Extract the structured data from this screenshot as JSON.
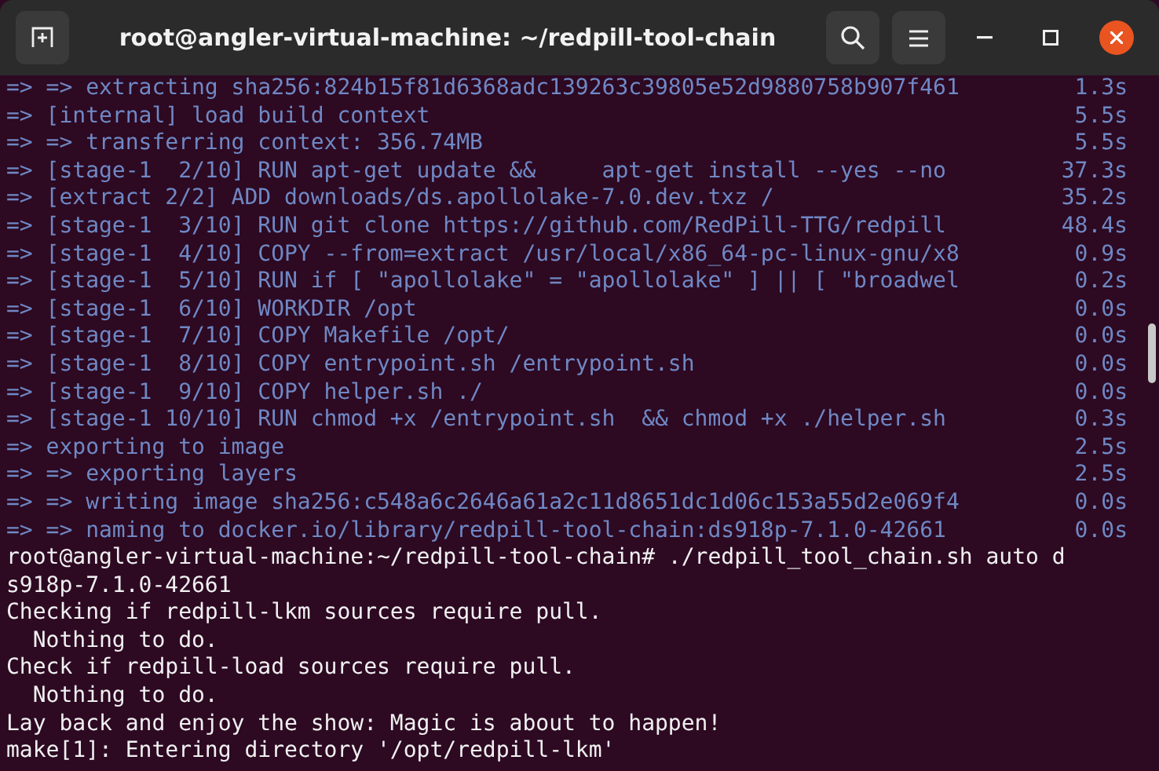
{
  "window": {
    "title": "root@angler-virtual-machine: ~/redpill-tool-chain"
  },
  "terminal": {
    "lines": [
      {
        "kind": "build",
        "text": "=> => extracting sha256:824b15f81d6368adc139263c39805e52d9880758b907f461",
        "time": "1.3s"
      },
      {
        "kind": "build",
        "text": "=> [internal] load build context",
        "time": "5.5s"
      },
      {
        "kind": "build",
        "text": "=> => transferring context: 356.74MB",
        "time": "5.5s"
      },
      {
        "kind": "build",
        "text": "=> [stage-1  2/10] RUN apt-get update &&     apt-get install --yes --no",
        "time": "37.3s"
      },
      {
        "kind": "build",
        "text": "=> [extract 2/2] ADD downloads/ds.apollolake-7.0.dev.txz /",
        "time": "35.2s"
      },
      {
        "kind": "build",
        "text": "=> [stage-1  3/10] RUN git clone https://github.com/RedPill-TTG/redpill",
        "time": "48.4s"
      },
      {
        "kind": "build",
        "text": "=> [stage-1  4/10] COPY --from=extract /usr/local/x86_64-pc-linux-gnu/x8",
        "time": "0.9s"
      },
      {
        "kind": "build",
        "text": "=> [stage-1  5/10] RUN if [ \"apollolake\" = \"apollolake\" ] || [ \"broadwel",
        "time": "0.2s"
      },
      {
        "kind": "build",
        "text": "=> [stage-1  6/10] WORKDIR /opt",
        "time": "0.0s"
      },
      {
        "kind": "build",
        "text": "=> [stage-1  7/10] COPY Makefile /opt/",
        "time": "0.0s"
      },
      {
        "kind": "build",
        "text": "=> [stage-1  8/10] COPY entrypoint.sh /entrypoint.sh",
        "time": "0.0s"
      },
      {
        "kind": "build",
        "text": "=> [stage-1  9/10] COPY helper.sh ./",
        "time": "0.0s"
      },
      {
        "kind": "build",
        "text": "=> [stage-1 10/10] RUN chmod +x /entrypoint.sh  && chmod +x ./helper.sh",
        "time": "0.3s"
      },
      {
        "kind": "build",
        "text": "=> exporting to image",
        "time": "2.5s"
      },
      {
        "kind": "build",
        "text": "=> => exporting layers",
        "time": "2.5s"
      },
      {
        "kind": "build",
        "text": "=> => writing image sha256:c548a6c2646a61a2c11d8651dc1d06c153a55d2e069f4",
        "time": "0.0s"
      },
      {
        "kind": "build",
        "text": "=> => naming to docker.io/library/redpill-tool-chain:ds918p-7.1.0-42661",
        "time": "0.0s"
      },
      {
        "kind": "output",
        "text": "root@angler-virtual-machine:~/redpill-tool-chain# ./redpill_tool_chain.sh auto d"
      },
      {
        "kind": "output",
        "text": "s918p-7.1.0-42661"
      },
      {
        "kind": "output",
        "text": "Checking if redpill-lkm sources require pull."
      },
      {
        "kind": "output",
        "text": "  Nothing to do."
      },
      {
        "kind": "output",
        "text": "Check if redpill-load sources require pull."
      },
      {
        "kind": "output",
        "text": "  Nothing to do."
      },
      {
        "kind": "output",
        "text": "Lay back and enjoy the show: Magic is about to happen!"
      },
      {
        "kind": "output",
        "text": "make[1]: Entering directory '/opt/redpill-lkm'"
      }
    ]
  }
}
